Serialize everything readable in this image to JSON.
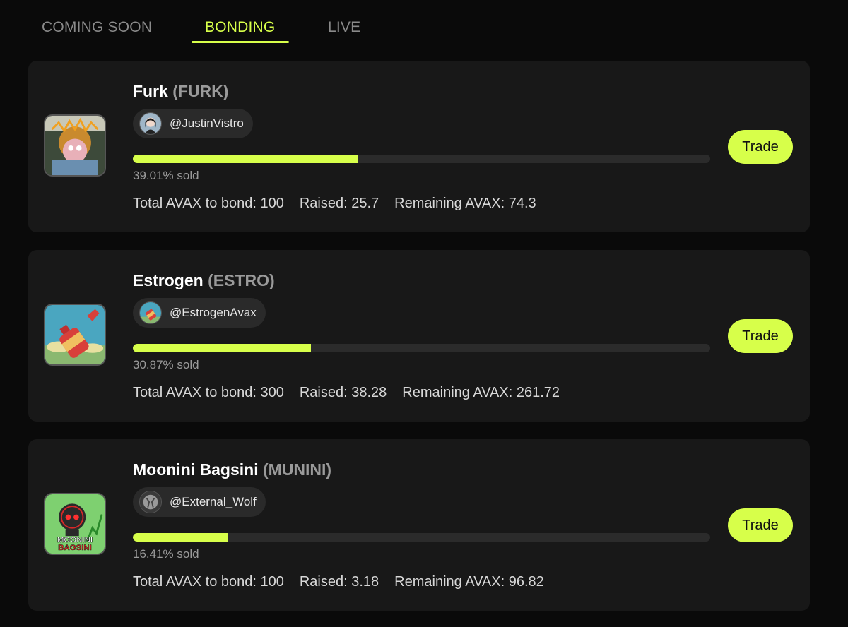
{
  "tabs": [
    {
      "label": "COMING SOON"
    },
    {
      "label": "BONDING"
    },
    {
      "label": "LIVE"
    }
  ],
  "accent_color": "#d7ff4a",
  "cards": [
    {
      "name": "Furk",
      "ticker": "(FURK)",
      "creator": "@JustinVistro",
      "progress": 0.3901,
      "sold_text": "39.01% sold",
      "total_bond": "Total AVAX to bond: 100",
      "raised": "Raised: 25.7",
      "remaining": "Remaining AVAX: 74.3",
      "trade_label": "Trade"
    },
    {
      "name": "Estrogen",
      "ticker": "(ESTRO)",
      "creator": "@EstrogenAvax",
      "progress": 0.3087,
      "sold_text": "30.87% sold",
      "total_bond": "Total AVAX to bond: 300",
      "raised": "Raised: 38.28",
      "remaining": "Remaining AVAX: 261.72",
      "trade_label": "Trade"
    },
    {
      "name": "Moonini Bagsini",
      "ticker": "(MUNINI)",
      "creator": "@External_Wolf",
      "progress": 0.1641,
      "sold_text": "16.41% sold",
      "total_bond": "Total AVAX to bond: 100",
      "raised": "Raised: 3.18",
      "remaining": "Remaining AVAX: 96.82",
      "trade_label": "Trade",
      "logo_text_top": "MOONINI",
      "logo_text_bottom": "BAGSINI"
    }
  ]
}
